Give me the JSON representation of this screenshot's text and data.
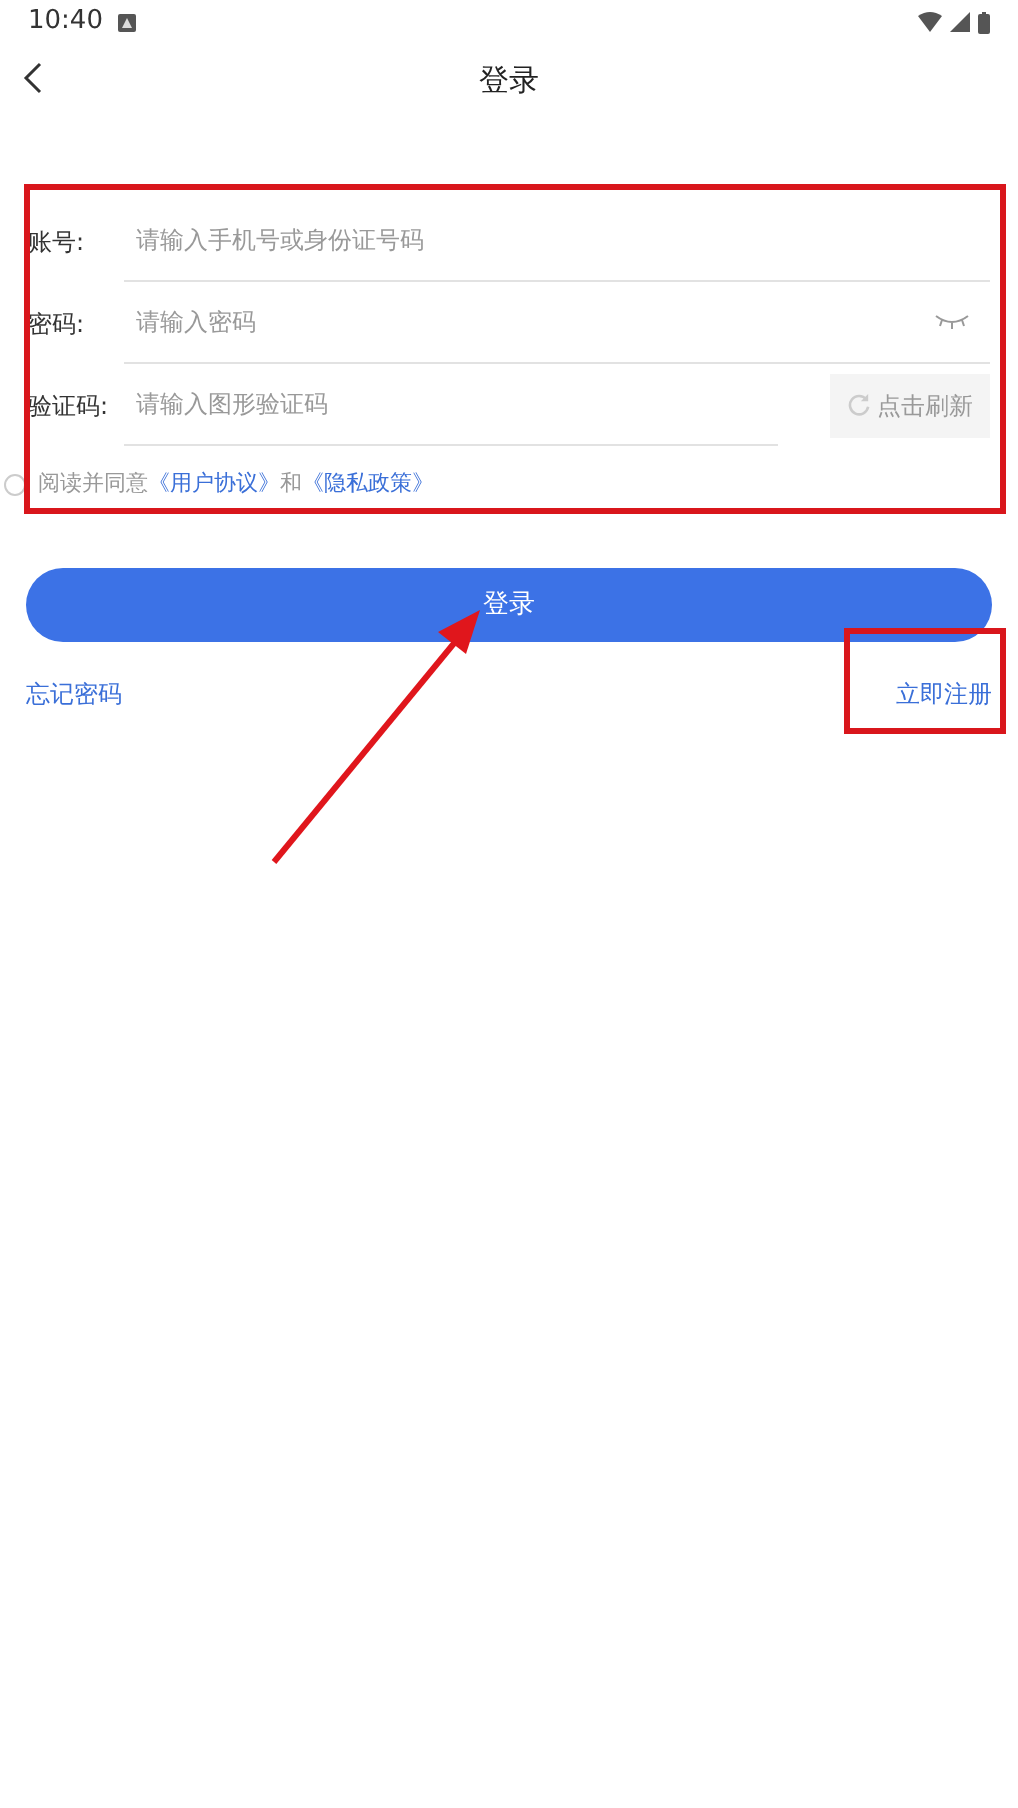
{
  "status_bar": {
    "time": "10:40"
  },
  "header": {
    "title": "登录"
  },
  "fields": [
    {
      "kind": "text",
      "label": "账号:",
      "placeholder": "请输入手机号或身份证号码"
    },
    {
      "kind": "password",
      "label": "密码:",
      "placeholder": "请输入密码"
    },
    {
      "kind": "captcha",
      "label": "验证码:",
      "placeholder": "请输入图形验证码",
      "button": "点击刷新"
    }
  ],
  "agreement": {
    "checked": false,
    "text": "阅读并同意",
    "links": [
      "《用户协议》",
      "《隐私政策》"
    ],
    "joiner": "和"
  },
  "login_button": "登录",
  "links": {
    "forgot": "忘记密码",
    "register": "立即注册"
  }
}
